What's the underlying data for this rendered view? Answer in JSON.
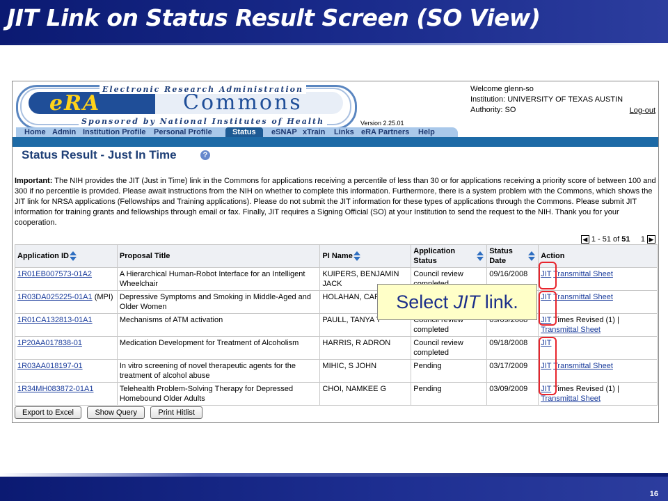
{
  "slide": {
    "title": "JIT Link on Status Result Screen (SO View)",
    "page_number": "16"
  },
  "banner": {
    "top_text": "Electronic Research Administration",
    "era": "eRA",
    "commons": "Commons",
    "bottom_text": "Sponsored by National Institutes of Health",
    "version": "Version 2.25.01"
  },
  "user": {
    "welcome": "Welcome  glenn-so",
    "institution": "Institution: UNIVERSITY OF TEXAS AUSTIN",
    "authority": "Authority:   SO",
    "logout": "Log-out"
  },
  "nav": {
    "items": [
      "Home",
      "Admin",
      "Institution Profile",
      "Personal Profile",
      "Status",
      "eSNAP",
      "xTrain",
      "Links",
      "eRA Partners",
      "Help"
    ],
    "active": "Status"
  },
  "page": {
    "title": "Status Result - Just In Time",
    "important_label": "Important:",
    "important_text": "The NIH provides the JIT (Just in Time) link in the Commons for applications receiving a percentile of less than 30 or for applications receiving a priority score of between 100 and 300 if no percentile is provided.  Please await instructions from the NIH on whether to complete this information.  Furthermore, there is a system problem with the Commons, which shows the JIT link for NRSA applications (Fellowships and Training applications).  Please do not submit the JIT information for these types of applications through the Commons. Please submit JIT information for training grants and fellowships through email or fax.  Finally, JIT requires a Signing Official (SO) at your Institution to send the request to the NIH.    Thank you for your cooperation."
  },
  "pager": {
    "range": "1 - 51 of",
    "total": "51",
    "page": "1"
  },
  "table": {
    "headers": {
      "app_id": "Application ID",
      "title": "Proposal Title",
      "pi": "PI Name",
      "status": "Application Status",
      "date": "Status Date",
      "action": "Action"
    },
    "rows": [
      {
        "app_id": "1R01EB007573-01A2",
        "mpi": "",
        "title": "A Hierarchical Human-Robot Interface for an Intelligent Wheelchair",
        "pi": "KUIPERS, BENJAMIN JACK",
        "status": "Council review completed",
        "date": "09/16/2008",
        "jit": "JIT",
        "extra": "",
        "transmittal": "Transmittal Sheet"
      },
      {
        "app_id": "1R03DA025225-01A1",
        "mpi": "(MPI)",
        "title": "Depressive Symptoms and Smoking in Middle-Aged and Older Women",
        "pi": "HOLAHAN, CAR",
        "status": "",
        "date": "",
        "jit": "JIT",
        "extra": "",
        "transmittal": "Transmittal Sheet"
      },
      {
        "app_id": "1R01CA132813-01A1",
        "mpi": "",
        "title": "Mechanisms of ATM activation",
        "pi": "PAULL, TANYA T",
        "status": "Council review completed",
        "date": "09/09/2008",
        "jit": "JIT",
        "extra": "Times Revised (1) |",
        "transmittal": "Transmittal Sheet"
      },
      {
        "app_id": "1P20AA017838-01",
        "mpi": "",
        "title": "Medication Development for Treatment of Alcoholism",
        "pi": "HARRIS, R ADRON",
        "status": "Council review completed",
        "date": "09/18/2008",
        "jit": "JIT",
        "extra": "",
        "transmittal": ""
      },
      {
        "app_id": "1R03AA018197-01",
        "mpi": "",
        "title": "In vitro screening of novel therapeutic agents for the treatment of alcohol abuse",
        "pi": "MIHIC, S JOHN",
        "status": "Pending",
        "date": "03/17/2009",
        "jit": "JIT",
        "extra": "",
        "transmittal": "Transmittal Sheet"
      },
      {
        "app_id": "1R34MH083872-01A1",
        "mpi": "",
        "title": "Telehealth Problem-Solving Therapy for Depressed Homebound Older Adults",
        "pi": "CHOI, NAMKEE G",
        "status": "Pending",
        "date": "03/09/2009",
        "jit": "JIT",
        "extra": "Times Revised (1) |",
        "transmittal": "Transmittal Sheet"
      }
    ]
  },
  "buttons": {
    "export": "Export to Excel",
    "show_query": "Show Query",
    "print": "Print Hitlist"
  },
  "callout": {
    "prefix": "Select ",
    "emphasis": "JIT",
    "suffix": " link."
  }
}
